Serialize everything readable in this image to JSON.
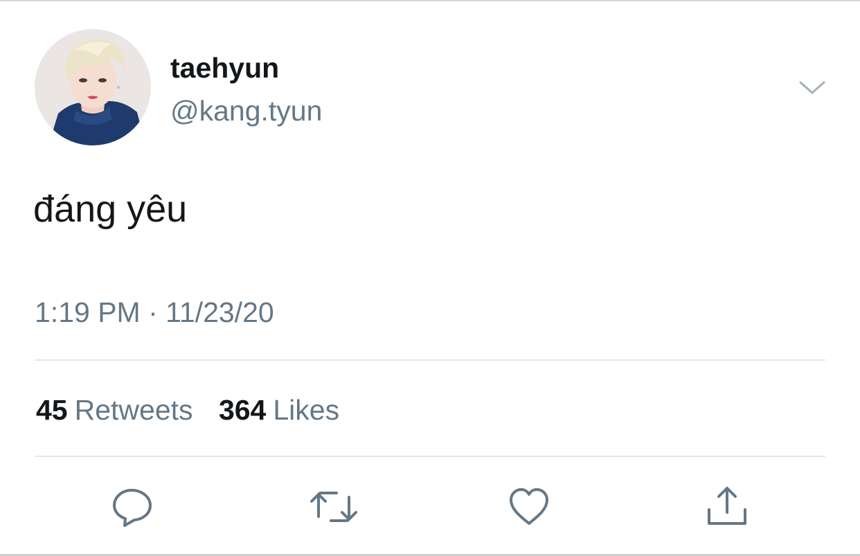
{
  "tweet": {
    "author": {
      "display_name": "taehyun",
      "handle": "@kang.tyun",
      "avatar": "profile-photo"
    },
    "text": "đáng yêu",
    "timestamp": "1:19 PM · 11/23/20",
    "stats": {
      "retweets_count": "45",
      "retweets_label": "Retweets",
      "likes_count": "364",
      "likes_label": "Likes"
    },
    "actions": {
      "reply_icon": "speech-bubble-icon",
      "retweet_icon": "retweet-arrows-icon",
      "like_icon": "heart-icon",
      "share_icon": "share-upload-icon",
      "menu_icon": "chevron-down-icon"
    }
  },
  "colors": {
    "primary_text": "#14171a",
    "secondary_text": "#657786",
    "icon": "#657786",
    "divider": "#e1e8ed",
    "background": "#ffffff"
  }
}
